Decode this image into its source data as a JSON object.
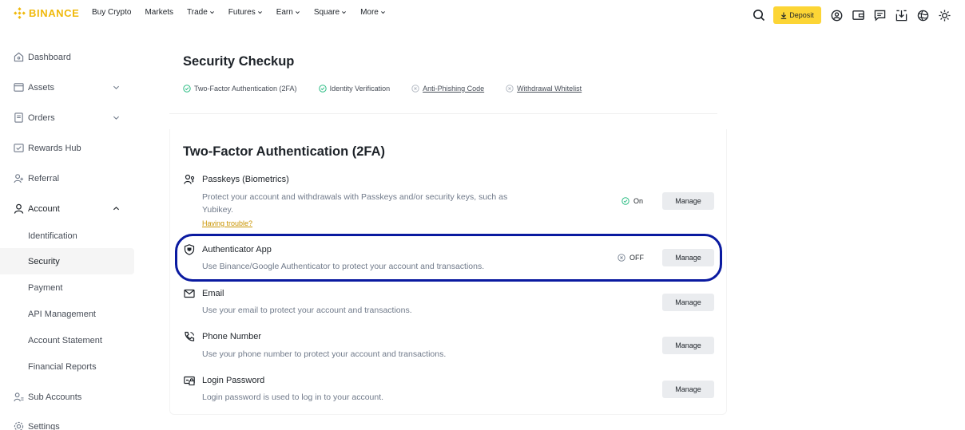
{
  "brand": {
    "name": "BINANCE",
    "color": "#f0b90b",
    "logo_icon": "binance-logo-icon"
  },
  "nav": {
    "items": [
      {
        "label": "Buy Crypto",
        "has_menu": false
      },
      {
        "label": "Markets",
        "has_menu": false
      },
      {
        "label": "Trade",
        "has_menu": true
      },
      {
        "label": "Futures",
        "has_menu": true
      },
      {
        "label": "Earn",
        "has_menu": true
      },
      {
        "label": "Square",
        "has_menu": true
      },
      {
        "label": "More",
        "has_menu": true
      }
    ],
    "deposit_label": "Deposit",
    "right_icons": [
      "search-icon",
      "profile-icon",
      "wallet-icon",
      "messages-icon",
      "download-icon",
      "language-icon",
      "theme-icon"
    ]
  },
  "sidebar": {
    "items": [
      {
        "label": "Dashboard",
        "icon": "home-icon"
      },
      {
        "label": "Assets",
        "icon": "assets-icon",
        "expand": "collapsed"
      },
      {
        "label": "Orders",
        "icon": "orders-icon",
        "expand": "collapsed"
      },
      {
        "label": "Rewards Hub",
        "icon": "rewards-icon"
      },
      {
        "label": "Referral",
        "icon": "referral-icon"
      },
      {
        "label": "Account",
        "icon": "account-icon",
        "expand": "expanded"
      },
      {
        "label": "Identification",
        "sub": true
      },
      {
        "label": "Security",
        "sub": true,
        "active": true
      },
      {
        "label": "Payment",
        "sub": true
      },
      {
        "label": "API Management",
        "sub": true
      },
      {
        "label": "Account Statement",
        "sub": true
      },
      {
        "label": "Financial Reports",
        "sub": true
      },
      {
        "label": "Sub Accounts",
        "icon": "sub-accounts-icon"
      },
      {
        "label": "Settings",
        "icon": "settings-icon"
      }
    ]
  },
  "security_checkup": {
    "title": "Security Checkup",
    "checks": [
      {
        "label": "Two-Factor Authentication (2FA)",
        "done": true
      },
      {
        "label": "Identity Verification",
        "done": true
      },
      {
        "label": "Anti-Phishing Code",
        "done": false
      },
      {
        "label": "Withdrawal Whitelist",
        "done": false
      }
    ]
  },
  "two_fa": {
    "title": "Two-Factor Authentication (2FA)",
    "rows": [
      {
        "title": "Passkeys (Biometrics)",
        "desc": "Protect your account and withdrawals with Passkeys and/or security keys, such as Yubikey.",
        "status": "On",
        "status_ok": true,
        "help": "Having trouble?",
        "button": "Manage",
        "icon": "passkey-icon"
      },
      {
        "title": "Authenticator App",
        "desc": "Use Binance/Google Authenticator to protect your account and transactions.",
        "status": "OFF",
        "status_ok": false,
        "button": "Manage",
        "icon": "authenticator-shield-icon"
      },
      {
        "title": "Email",
        "desc": "Use your email to protect your account and transactions.",
        "button": "Manage",
        "icon": "email-icon"
      },
      {
        "title": "Phone Number",
        "desc": "Use your phone number to protect your account and transactions.",
        "button": "Manage",
        "icon": "phone-icon"
      },
      {
        "title": "Login Password",
        "desc": "Login password is used to log in to your account.",
        "button": "Manage",
        "icon": "password-icon"
      }
    ]
  },
  "colors": {
    "accent": "#fcd535",
    "ok": "#2ebd85",
    "highlight": "#0a1aa0",
    "muted": "#707a8a"
  }
}
